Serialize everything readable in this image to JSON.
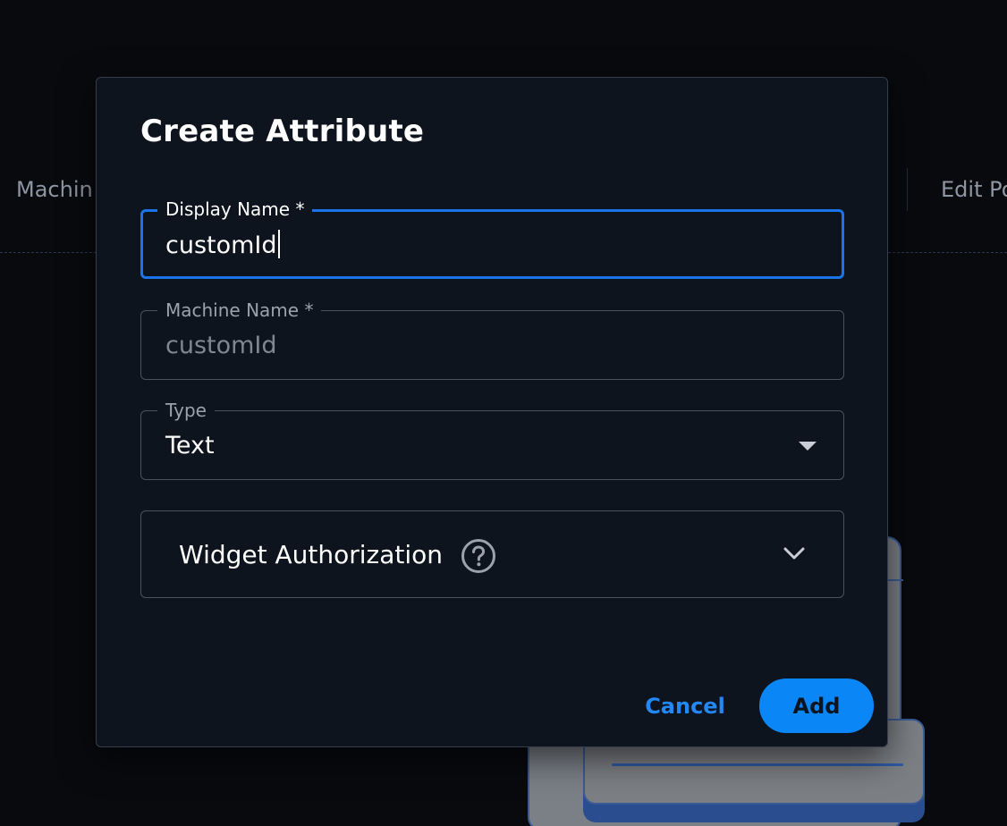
{
  "background": {
    "tab_left": "Machin",
    "tab_right": "Edit Po"
  },
  "modal": {
    "title": "Create Attribute",
    "fields": {
      "display_name": {
        "label": "Display Name *",
        "value": "customId"
      },
      "machine_name": {
        "label": "Machine Name *",
        "value": "customId"
      },
      "type": {
        "label": "Type",
        "value": "Text"
      }
    },
    "accordion": {
      "label": "Widget Authorization"
    },
    "buttons": {
      "cancel": "Cancel",
      "add": "Add"
    }
  },
  "icons": {
    "help": "help-circle-icon",
    "dropdown": "caret-down-icon",
    "expand": "chevron-down-icon"
  },
  "colors": {
    "accent": "#0b86f6",
    "focus_border": "#1a73e8",
    "surface": "#0e141d",
    "backdrop": "#080a0e"
  }
}
